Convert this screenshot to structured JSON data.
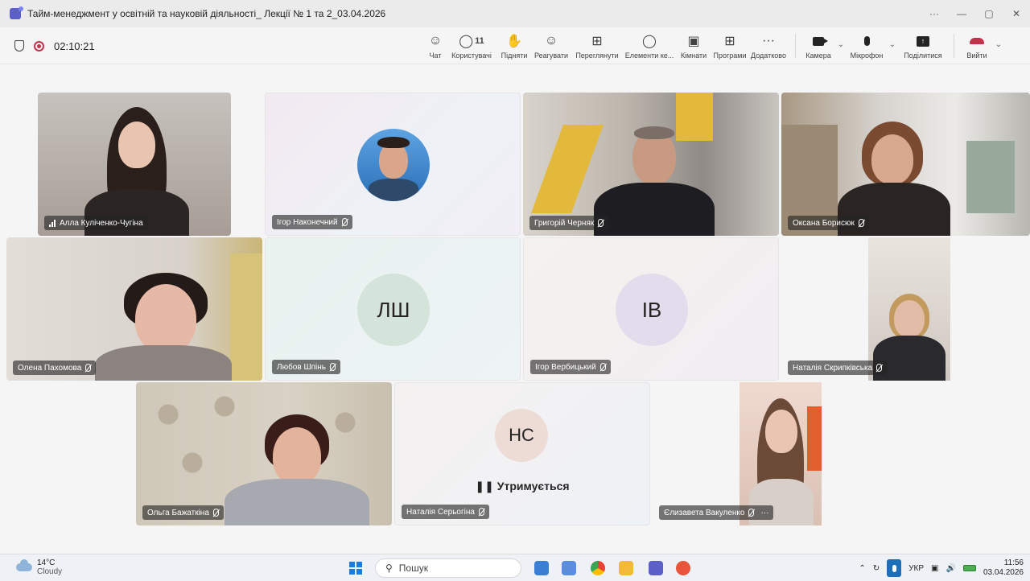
{
  "window": {
    "title": "Тайм-менеджмент у освітній та науковій діяльності_ Лекції № 1 та 2_03.04.2026",
    "controls": [
      "···",
      "—",
      "▢",
      "✕"
    ]
  },
  "meeting": {
    "timer": "02:10:21",
    "participants_count": "11",
    "tools": [
      {
        "label": "Чат",
        "icon": "chat-icon"
      },
      {
        "label": "Користувачі",
        "icon": "people-icon"
      },
      {
        "label": "Підняти",
        "icon": "raise-hand-icon"
      },
      {
        "label": "Реагувати",
        "icon": "react-icon"
      },
      {
        "label": "Переглянути",
        "icon": "view-icon"
      },
      {
        "label": "Елементи ке...",
        "icon": "host-tools-icon"
      },
      {
        "label": "Кімнати",
        "icon": "rooms-icon"
      },
      {
        "label": "Програми",
        "icon": "apps-icon"
      },
      {
        "label": "Додатково",
        "icon": "more-icon"
      }
    ],
    "camera_label": "Камера",
    "mic_label": "Мікрофон",
    "share_label": "Поділитися",
    "leave_label": "Вийти"
  },
  "tiles": {
    "t1": {
      "name": "Алла Куліченко-Чугіна"
    },
    "t2": {
      "name": "Ігор Наконечний"
    },
    "t3": {
      "name": "Григорій Черняк"
    },
    "t4": {
      "name": "Оксана Борисюк"
    },
    "t5": {
      "name": "Олена Пахомова"
    },
    "t6": {
      "name": "Любов Шпінь",
      "initials": "ЛШ"
    },
    "t7": {
      "name": "Ігор Вербицький",
      "initials": "ІВ"
    },
    "t8": {
      "name": "Наталія Скрипківська"
    },
    "t9": {
      "name": "Ольга Бажаткіна"
    },
    "t10": {
      "name": "Наталія Серьогіна",
      "initials": "НС",
      "status": "Утримується"
    },
    "t11": {
      "name": "Єлизавета Вакуленко"
    }
  },
  "taskbar": {
    "temperature": "14°C",
    "weather": "Cloudy",
    "search_placeholder": "Пошук",
    "language": "УКР",
    "time": "11:56",
    "date": "03.04.2026"
  },
  "colors": {
    "accent": "#5b5fc7",
    "leave": "#c4314b",
    "recording": "#c4314b"
  }
}
